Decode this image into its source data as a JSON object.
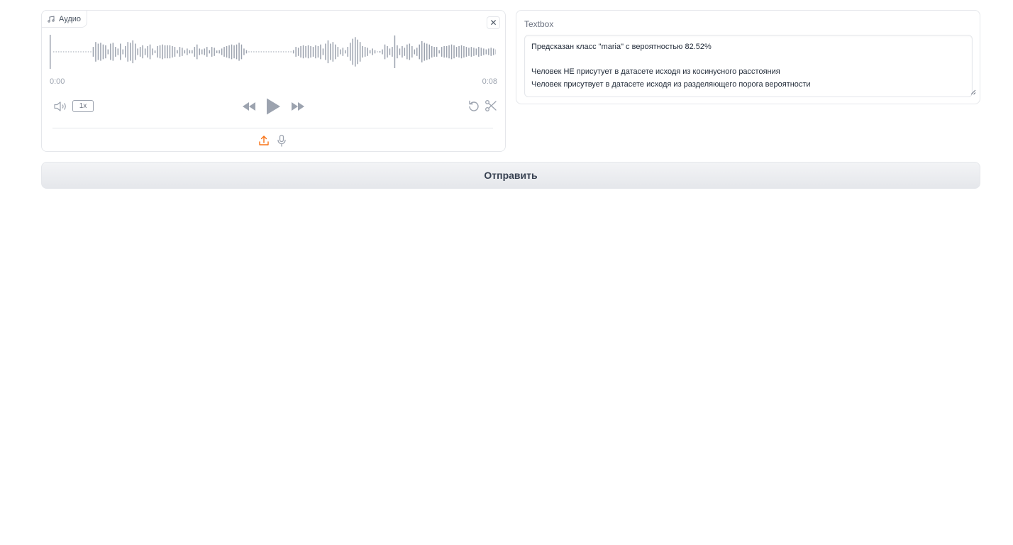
{
  "audio": {
    "label": "Аудио",
    "close_symbol": "✕",
    "time_current": "0:00",
    "time_total": "0:08",
    "playback_rate": "1x",
    "icons": [
      "music-note-icon",
      "close-icon",
      "volume-icon",
      "rewind-icon",
      "play-icon",
      "fast-forward-icon",
      "undo-icon",
      "scissors-icon",
      "upload-icon",
      "microphone-icon"
    ],
    "accent_color": "#f97316",
    "icon_color": "#9ca3af",
    "waveform_color": "#9ca3af",
    "playhead_fraction": 0,
    "waveform_amplitudes": [
      0.02,
      0.02,
      0.02,
      0.02,
      0.02,
      0.02,
      0.02,
      0.02,
      0.02,
      0.02,
      0.02,
      0.02,
      0.02,
      0.02,
      0.02,
      0.02,
      0.3,
      0.6,
      0.5,
      0.55,
      0.45,
      0.4,
      0.15,
      0.5,
      0.55,
      0.3,
      0.2,
      0.5,
      0.15,
      0.35,
      0.6,
      0.55,
      0.7,
      0.5,
      0.2,
      0.3,
      0.4,
      0.2,
      0.35,
      0.45,
      0.2,
      0.08,
      0.35,
      0.4,
      0.45,
      0.4,
      0.4,
      0.4,
      0.35,
      0.3,
      0.1,
      0.3,
      0.25,
      0.1,
      0.2,
      0.1,
      0.1,
      0.3,
      0.45,
      0.2,
      0.15,
      0.2,
      0.3,
      0.1,
      0.3,
      0.25,
      0.08,
      0.1,
      0.2,
      0.3,
      0.35,
      0.4,
      0.45,
      0.4,
      0.45,
      0.55,
      0.45,
      0.2,
      0.1,
      0.02,
      0.02,
      0.02,
      0.02,
      0.02,
      0.02,
      0.02,
      0.02,
      0.02,
      0.02,
      0.02,
      0.02,
      0.02,
      0.02,
      0.02,
      0.02,
      0.02,
      0.02,
      0.1,
      0.3,
      0.25,
      0.35,
      0.4,
      0.35,
      0.4,
      0.35,
      0.3,
      0.4,
      0.35,
      0.45,
      0.2,
      0.5,
      0.7,
      0.5,
      0.6,
      0.45,
      0.3,
      0.15,
      0.25,
      0.1,
      0.3,
      0.55,
      0.8,
      0.9,
      0.75,
      0.6,
      0.35,
      0.3,
      0.25,
      0.1,
      0.2,
      0.1,
      0.02,
      0.05,
      0.15,
      0.45,
      0.35,
      0.2,
      0.3,
      1.0,
      0.4,
      0.2,
      0.35,
      0.25,
      0.45,
      0.5,
      0.35,
      0.15,
      0.25,
      0.45,
      0.65,
      0.55,
      0.5,
      0.45,
      0.35,
      0.3,
      0.3,
      0.1,
      0.3,
      0.35,
      0.35,
      0.4,
      0.45,
      0.4,
      0.3,
      0.35,
      0.4,
      0.35,
      0.3,
      0.25,
      0.3,
      0.25,
      0.2,
      0.3,
      0.25,
      0.2,
      0.15,
      0.2,
      0.25,
      0.2,
      0.15
    ]
  },
  "textbox": {
    "label": "Textbox",
    "value": "Предсказан класс \"maria\" с вероятностью 82.52%\n\nЧеловек НЕ присутует в датасете исходя из косинусного расстояния\nЧеловек присутвует в датасете исходя из разделяющего порога вероятности"
  },
  "submit": {
    "label": "Отправить"
  }
}
